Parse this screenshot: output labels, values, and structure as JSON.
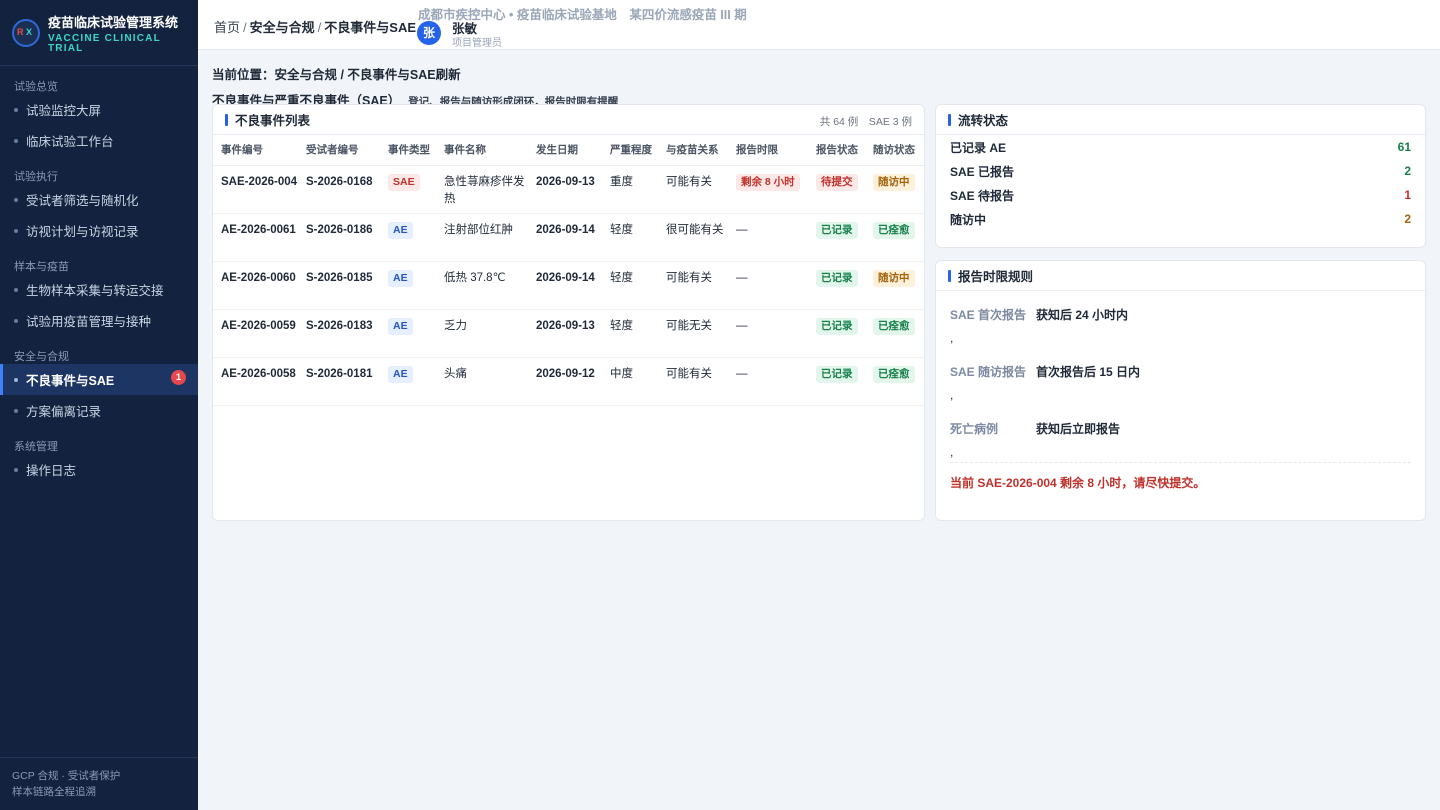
{
  "app": {
    "logo_text_r": "R",
    "logo_text_x": "X",
    "title": "疫苗临床试验管理系统",
    "subtitle": "VACCINE CLINICAL TRIAL"
  },
  "sidebar": {
    "groups": [
      {
        "label": "试验总览",
        "items": [
          {
            "label": "试验监控大屏"
          },
          {
            "label": "临床试验工作台"
          }
        ]
      },
      {
        "label": "试验执行",
        "items": [
          {
            "label": "受试者筛选与随机化"
          },
          {
            "label": "访视计划与访视记录"
          }
        ]
      },
      {
        "label": "样本与疫苗",
        "items": [
          {
            "label": "生物样本采集与转运交接"
          },
          {
            "label": "试验用疫苗管理与接种"
          }
        ]
      },
      {
        "label": "安全与合规",
        "items": [
          {
            "label": "不良事件与SAE",
            "badge": "1",
            "active": true
          },
          {
            "label": "方案偏离记录"
          }
        ]
      },
      {
        "label": "系统管理",
        "items": [
          {
            "label": "操作日志"
          }
        ]
      }
    ],
    "footer_line1": "GCP 合规 · 受试者保护",
    "footer_line2": "样本链路全程追溯"
  },
  "header": {
    "crumb_home": "首页",
    "crumb_sep1": "/",
    "crumb_section": "安全与合规",
    "crumb_sep2": "/",
    "crumb_page": "不良事件与SAE",
    "org": "成都市疾控中心 • 疫苗临床试验基地　某四价流感疫苗 III 期",
    "avatar_char": "张",
    "user_name": "张敏",
    "user_role": "项目管理员"
  },
  "page": {
    "location": "当前位置：安全与合规 / 不良事件与SAE刷新",
    "title": "不良事件与严重不良事件（SAE）",
    "description": "登记、报告与随访形成闭环，报告时限有提醒"
  },
  "ae_list": {
    "title": "不良事件列表",
    "meta": "共 64 例　SAE 3 例",
    "columns": [
      "事件编号",
      "受试者编号",
      "事件类型",
      "事件名称",
      "发生日期",
      "严重程度",
      "与疫苗关系",
      "报告时限",
      "报告状态",
      "随访状态"
    ],
    "rows": [
      {
        "id": "SAE-2026-004",
        "subject": "S-2026-0168",
        "type": "SAE",
        "name": "急性荨麻疹伴发热",
        "date": "2026-09-13",
        "severity": "重度",
        "relation": "可能有关",
        "deadline": "剩余 8 小时",
        "report": "待提交",
        "followup": "随访中"
      },
      {
        "id": "AE-2026-0061",
        "subject": "S-2026-0186",
        "type": "AE",
        "name": "注射部位红肿",
        "date": "2026-09-14",
        "severity": "轻度",
        "relation": "很可能有关",
        "deadline": "—",
        "report": "已记录",
        "followup": "已痊愈"
      },
      {
        "id": "AE-2026-0060",
        "subject": "S-2026-0185",
        "type": "AE",
        "name": "低热 37.8℃",
        "date": "2026-09-14",
        "severity": "轻度",
        "relation": "可能有关",
        "deadline": "—",
        "report": "已记录",
        "followup": "随访中"
      },
      {
        "id": "AE-2026-0059",
        "subject": "S-2026-0183",
        "type": "AE",
        "name": "乏力",
        "date": "2026-09-13",
        "severity": "轻度",
        "relation": "可能无关",
        "deadline": "—",
        "report": "已记录",
        "followup": "已痊愈"
      },
      {
        "id": "AE-2026-0058",
        "subject": "S-2026-0181",
        "type": "AE",
        "name": "头痛",
        "date": "2026-09-12",
        "severity": "中度",
        "relation": "可能有关",
        "deadline": "—",
        "report": "已记录",
        "followup": "已痊愈"
      }
    ]
  },
  "flow": {
    "title": "流转状态",
    "items": [
      {
        "label": "已记录 AE",
        "value": "61",
        "color": "#17804a"
      },
      {
        "label": "SAE 已报告",
        "value": "2",
        "color": "#17804a"
      },
      {
        "label": "SAE 待报告",
        "value": "1",
        "color": "#c0312b"
      },
      {
        "label": "随访中",
        "value": "2",
        "color": "#a46308"
      }
    ]
  },
  "rules": {
    "title": "报告时限规则",
    "items": [
      {
        "label": "SAE 首次报告",
        "value": "获知后 24 小时内",
        "comma": ","
      },
      {
        "label": "SAE 随访报告",
        "value": "首次报告后 15 日内",
        "comma": ","
      },
      {
        "label": "死亡病例",
        "value": "获知后立即报告",
        "comma": ","
      }
    ],
    "warning": "当前 SAE-2026-004 剩余 8 小时，请尽快提交。"
  },
  "colors": {
    "sidebar_bg": "#13233f",
    "accent": "#2563eb",
    "danger": "#c0312b",
    "success": "#17804a",
    "warning": "#a46308"
  }
}
